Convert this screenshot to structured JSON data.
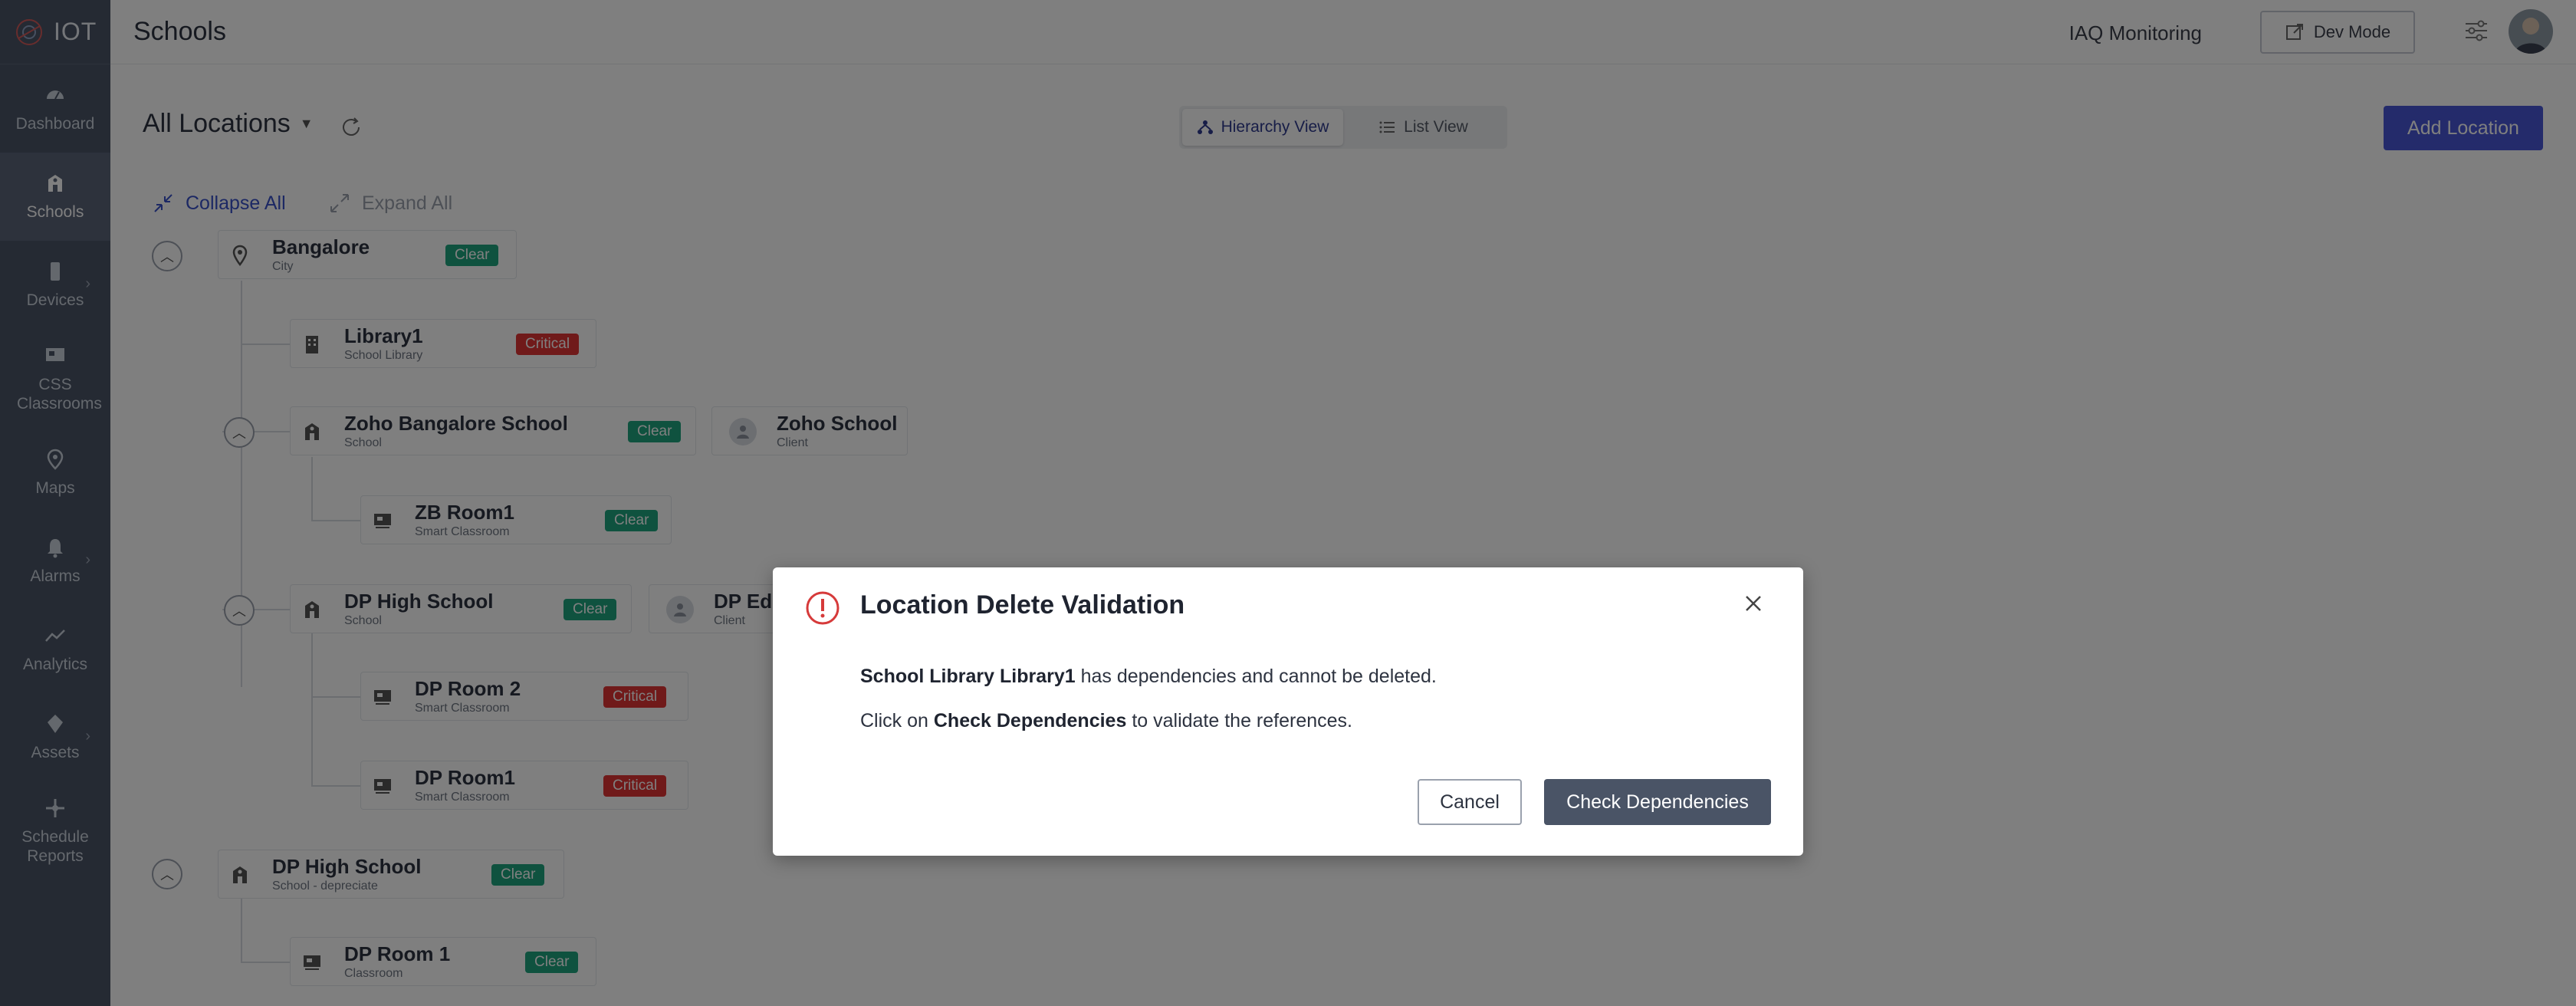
{
  "app": {
    "name": "IOT"
  },
  "sidebar": {
    "items": [
      {
        "label": "Dashboard",
        "icon": "dashboard-icon",
        "active": false
      },
      {
        "label": "Schools",
        "icon": "schools-icon",
        "active": true
      },
      {
        "label": "Devices",
        "icon": "devices-icon",
        "active": false,
        "has_submenu": true
      },
      {
        "label": "CSS Classrooms",
        "icon": "classroom-icon",
        "active": false
      },
      {
        "label": "Maps",
        "icon": "map-pin-icon",
        "active": false
      },
      {
        "label": "Alarms",
        "icon": "bell-icon",
        "active": false,
        "has_submenu": true
      },
      {
        "label": "Analytics",
        "icon": "analytics-icon",
        "active": false
      },
      {
        "label": "Assets",
        "icon": "assets-icon",
        "active": false,
        "has_submenu": true
      },
      {
        "label": "Schedule Reports",
        "icon": "schedule-icon",
        "active": false
      }
    ]
  },
  "header": {
    "title": "Schools",
    "iaq_label": "IAQ Monitoring",
    "dev_mode_label": "Dev Mode"
  },
  "toolbar": {
    "location_selector": "All Locations",
    "hierarchy_view": "Hierarchy View",
    "list_view": "List View",
    "add_location": "Add Location",
    "collapse_all": "Collapse All",
    "expand_all": "Expand All"
  },
  "tree": [
    {
      "name": "Bangalore",
      "type": "City",
      "status": "Clear"
    },
    {
      "name": "Library1",
      "type": "School Library",
      "status": "Critical"
    },
    {
      "name": "Zoho Bangalore School",
      "type": "School",
      "status": "Clear",
      "client": {
        "name": "Zoho School",
        "type": "Client"
      }
    },
    {
      "name": "ZB Room1",
      "type": "Smart Classroom",
      "status": "Clear"
    },
    {
      "name": "DP High School",
      "type": "School",
      "status": "Clear",
      "client": {
        "name": "DP Edu",
        "type": "Client"
      }
    },
    {
      "name": "DP Room 2",
      "type": "Smart Classroom",
      "status": "Critical"
    },
    {
      "name": "DP Room1",
      "type": "Smart Classroom",
      "status": "Critical"
    },
    {
      "name": "DP High School",
      "type": "School - depreciate",
      "status": "Clear"
    },
    {
      "name": "DP Room 1",
      "type": "Classroom",
      "status": "Clear"
    }
  ],
  "modal": {
    "title": "Location Delete Validation",
    "line1_bold": "School Library Library1",
    "line1_rest": " has dependencies and cannot be deleted.",
    "line2_prefix": "Click on ",
    "line2_bold": "Check Dependencies",
    "line2_suffix": " to validate the references.",
    "cancel_label": "Cancel",
    "check_label": "Check Dependencies"
  },
  "colors": {
    "sidebar": "#4a5466",
    "accent": "#4856d6",
    "clear": "#1fa57e",
    "critical": "#e03535",
    "alert": "#d63a3a"
  }
}
